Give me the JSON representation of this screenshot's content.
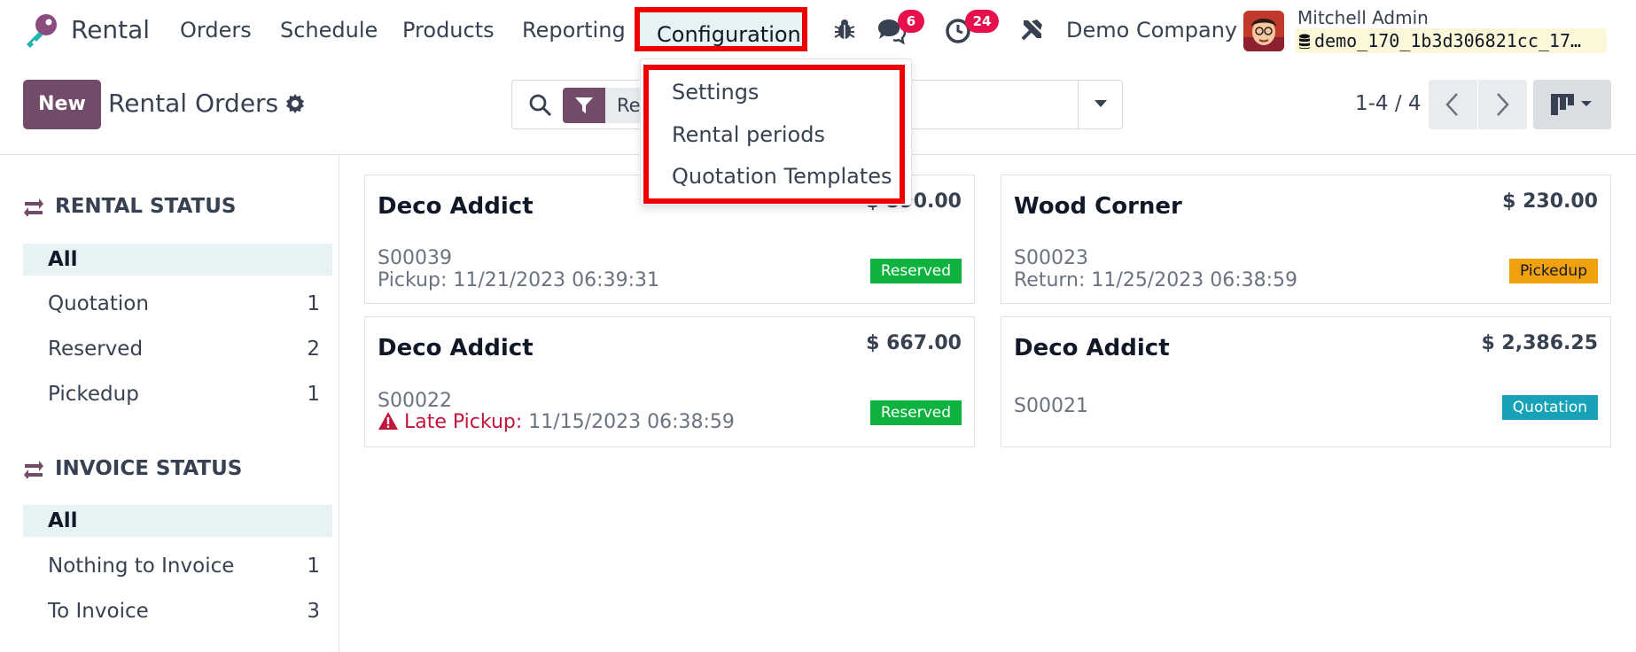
{
  "app": {
    "name": "Rental"
  },
  "menu": {
    "orders": "Orders",
    "schedule": "Schedule",
    "products": "Products",
    "reporting": "Reporting",
    "configuration": "Configuration"
  },
  "systray": {
    "messages_badge": "6",
    "activities_badge": "24",
    "company": "Demo Company",
    "user_name": "Mitchell Admin",
    "database": "demo_170_1b3d306821cc_17…"
  },
  "dropdown": {
    "items": [
      "Settings",
      "Rental periods",
      "Quotation Templates"
    ]
  },
  "control_panel": {
    "new_label": "New",
    "title": "Rental Orders",
    "facet_text": "Re",
    "pager": "1-4 / 4"
  },
  "sidebar": {
    "rental_status": {
      "title": "RENTAL STATUS",
      "items": [
        {
          "label": "All",
          "count": ""
        },
        {
          "label": "Quotation",
          "count": "1"
        },
        {
          "label": "Reserved",
          "count": "2"
        },
        {
          "label": "Pickedup",
          "count": "1"
        }
      ]
    },
    "invoice_status": {
      "title": "INVOICE STATUS",
      "items": [
        {
          "label": "All",
          "count": ""
        },
        {
          "label": "Nothing to Invoice",
          "count": "1"
        },
        {
          "label": "To Invoice",
          "count": "3"
        }
      ]
    }
  },
  "cards": [
    {
      "customer": "Deco Addict",
      "amount": "$ 590.00",
      "ref": "S00039",
      "line": "Pickup: 11/21/2023 06:39:31",
      "status": "Reserved"
    },
    {
      "customer": "Wood Corner",
      "amount": "$ 230.00",
      "ref": "S00023",
      "line": "Return: 11/25/2023 06:38:59",
      "status": "Pickedup"
    },
    {
      "customer": "Deco Addict",
      "amount": "$ 667.00",
      "ref": "S00022",
      "late_label": "Late Pickup:",
      "line": "11/15/2023 06:38:59",
      "status": "Reserved"
    },
    {
      "customer": "Deco Addict",
      "amount": "$ 2,386.25",
      "ref": "S00021",
      "status": "Quotation"
    }
  ],
  "colors": {
    "brand": "#714b67",
    "reserved": "#0eb33f",
    "pickedup": "#f0a10d",
    "quotation": "#17a2b8",
    "badge": "#e5104c",
    "highlight": "#ef0000"
  }
}
